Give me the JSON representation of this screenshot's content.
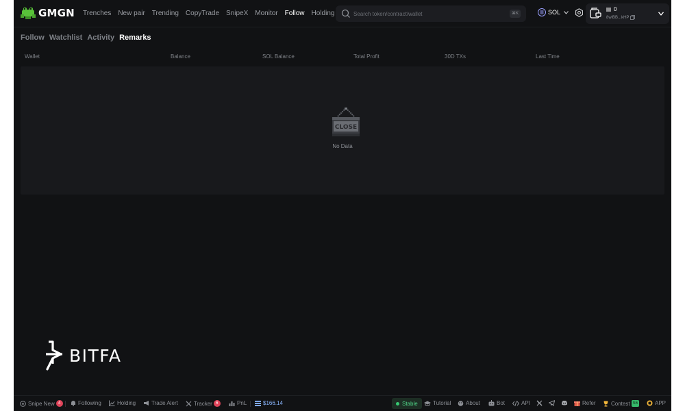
{
  "brand": {
    "name": "GMGN"
  },
  "nav": [
    "Trenches",
    "New pair",
    "Trending",
    "CopyTrade",
    "SnipeX",
    "Monitor",
    "Follow",
    "Holding"
  ],
  "nav_active": "Follow",
  "search": {
    "placeholder": "Search token/contract/wallet",
    "shortcut": "⌘K"
  },
  "chain": {
    "label": "SOL"
  },
  "wallet": {
    "balance": "0",
    "address": "8wlBB...kHP"
  },
  "tabs": [
    "Follow",
    "Watchlist",
    "Activity",
    "Remarks"
  ],
  "tab_active": "Remarks",
  "table": {
    "columns": [
      "Wallet",
      "Balance",
      "SOL Balance",
      "Total Profit",
      "30D TXs",
      "Last Time"
    ],
    "empty_sign": "CLOSE",
    "empty_text": "No Data"
  },
  "watermark": {
    "text": "BITFA"
  },
  "footer": {
    "snipe_new": "Snipe New",
    "snipe_new_count": "4",
    "following": "Following",
    "holding": "Holding",
    "trade_alert": "Trade Alert",
    "tracker": "Tracker",
    "tracker_count": "6",
    "pnl": "PnL",
    "sol_price": "$166.14",
    "status": "Stable",
    "tutorial": "Tutorial",
    "about": "About",
    "bot": "Bot",
    "api": "API",
    "refer": "Refer",
    "contest": "Contest",
    "contest_badge": "S6",
    "app": "APP"
  },
  "colors": {
    "background": "#111214",
    "panel": "#18191c",
    "accent_green": "#37c972",
    "badge_red": "#e0445a"
  }
}
